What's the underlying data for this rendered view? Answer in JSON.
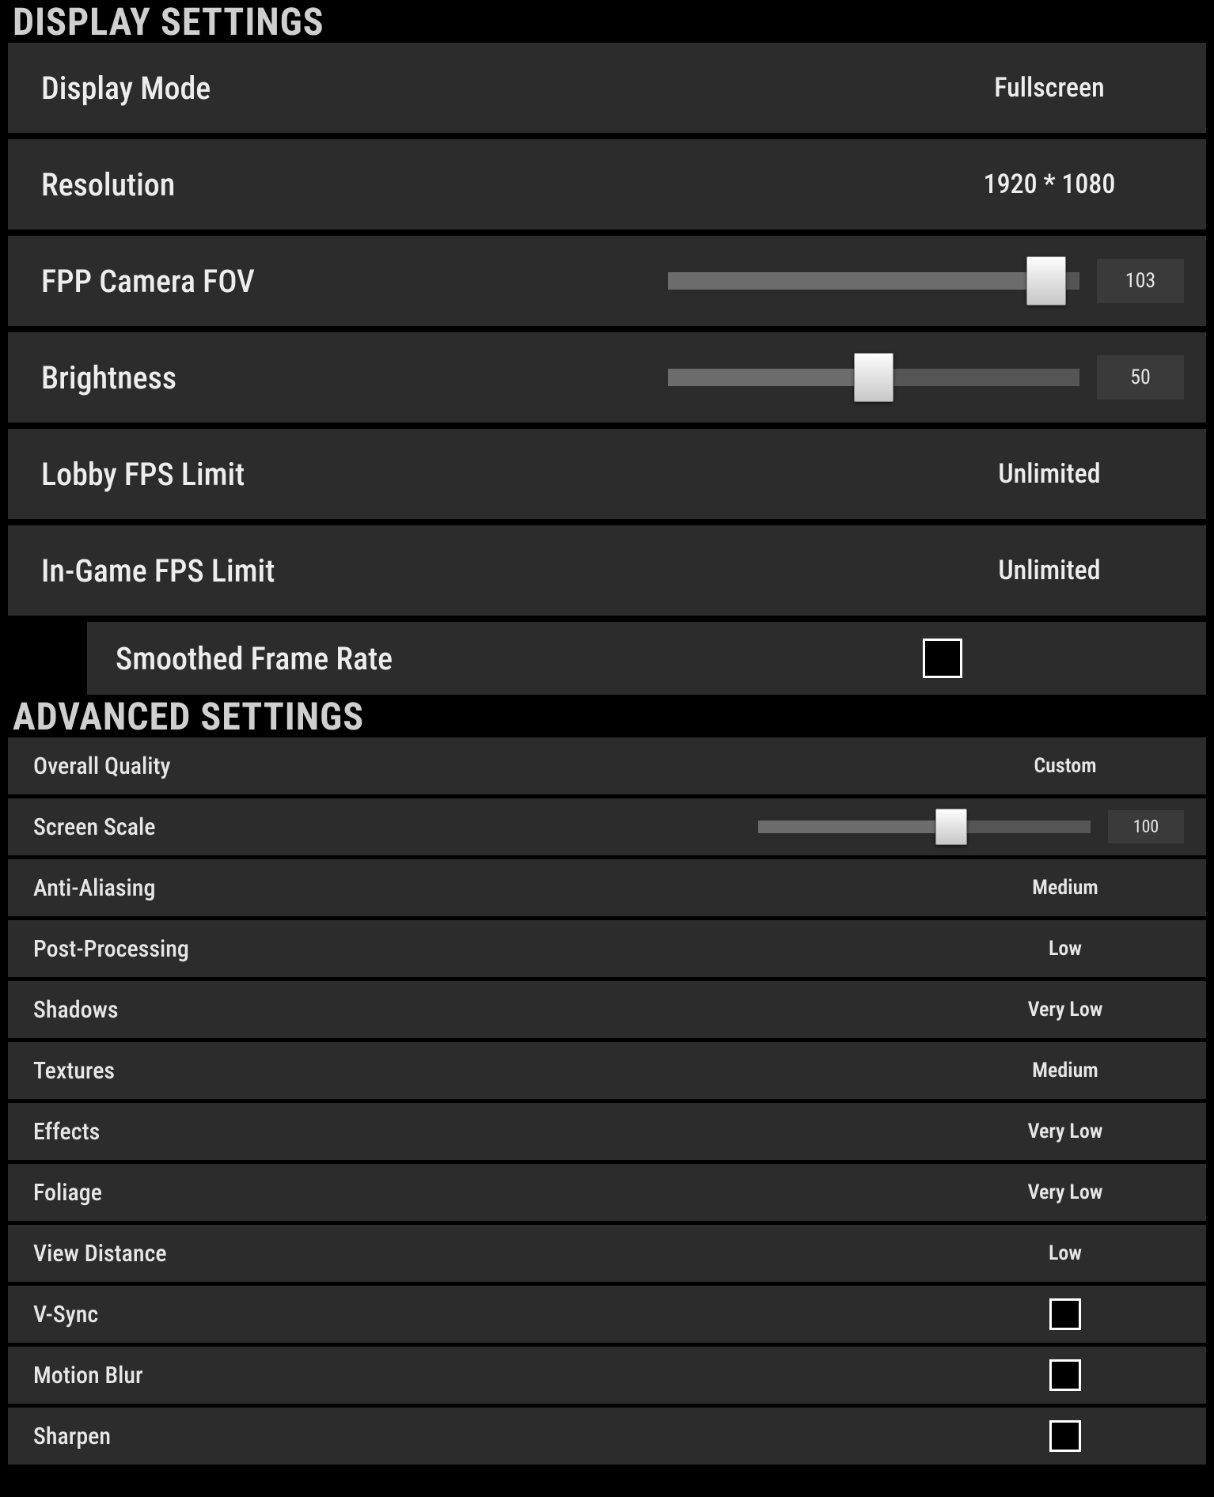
{
  "display": {
    "header": "Display Settings",
    "mode": {
      "label": "Display Mode",
      "value": "Fullscreen"
    },
    "resolution": {
      "label": "Resolution",
      "value": "1920 * 1080"
    },
    "fov": {
      "label": "FPP Camera FOV",
      "value": "103",
      "sliderFill": 0.92,
      "trackWidth": 520
    },
    "brightness": {
      "label": "Brightness",
      "value": "50",
      "sliderFill": 0.5,
      "trackWidth": 520
    },
    "lobbyfps": {
      "label": "Lobby FPS Limit",
      "value": "Unlimited"
    },
    "ingamefps": {
      "label": "In-Game FPS Limit",
      "value": "Unlimited"
    },
    "smoothed": {
      "label": "Smoothed Frame Rate",
      "checked": false
    }
  },
  "advanced": {
    "header": "Advanced Settings",
    "overall": {
      "label": "Overall Quality",
      "value": "Custom"
    },
    "scale": {
      "label": "Screen Scale",
      "value": "100",
      "sliderFill": 0.58,
      "trackWidth": 420
    },
    "aa": {
      "label": "Anti-Aliasing",
      "value": "Medium"
    },
    "post": {
      "label": "Post-Processing",
      "value": "Low"
    },
    "shadows": {
      "label": "Shadows",
      "value": "Very Low"
    },
    "textures": {
      "label": "Textures",
      "value": "Medium"
    },
    "effects": {
      "label": "Effects",
      "value": "Very Low"
    },
    "foliage": {
      "label": "Foliage",
      "value": "Very Low"
    },
    "view": {
      "label": "View Distance",
      "value": "Low"
    },
    "vsync": {
      "label": "V-Sync",
      "checked": false
    },
    "blur": {
      "label": "Motion Blur",
      "checked": false
    },
    "sharpen": {
      "label": "Sharpen",
      "checked": false
    }
  }
}
